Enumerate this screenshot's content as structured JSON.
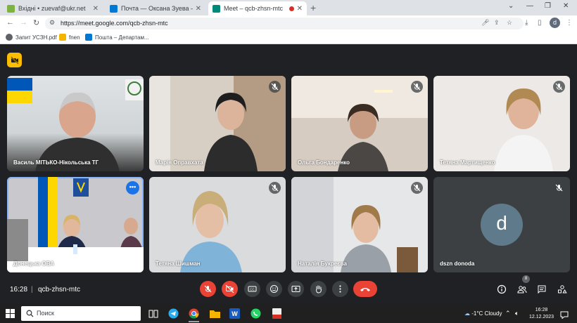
{
  "browser": {
    "tabs": [
      {
        "title": "Вхідні • zuevaf@ukr.net",
        "favicon_color": "#7cb342"
      },
      {
        "title": "Почта — Оксана Зуева — Outl",
        "favicon_color": "#0078d4"
      },
      {
        "title": "Meet – qcb-zhsn-mtc",
        "favicon_color": "#00897b",
        "recording": true
      }
    ],
    "url": "https://meet.google.com/qcb-zhsn-mtc",
    "profile_initial": "d",
    "bookmarks": [
      {
        "label": "Запит УСЗН.pdf",
        "icon": "globe-icon"
      },
      {
        "label": "fnen",
        "icon": "folder-icon",
        "color": "#f4b400"
      },
      {
        "label": "Пошта – Департам...",
        "icon": "outlook-icon",
        "color": "#0078d4"
      }
    ]
  },
  "meet": {
    "participants": [
      {
        "name": "Василь МІТЬКО-Нікольська ТГ",
        "muted": false
      },
      {
        "name": "Марія Оправхата",
        "muted": true
      },
      {
        "name": "Ольга Бондаренко",
        "muted": true
      },
      {
        "name": "Тетяна Мартищенко",
        "muted": true
      },
      {
        "name": "Донецька ОВА",
        "muted": false,
        "pinned_menu": true
      },
      {
        "name": "Тетяна Шишман",
        "muted": true
      },
      {
        "name": "Наталія Букреєва",
        "muted": true
      },
      {
        "name": "dszn donoda",
        "muted": true,
        "avatar_initial": "d"
      }
    ],
    "time": "16:28",
    "separator": "|",
    "meeting_code": "qcb-zhsn-mtc",
    "people_count": "8",
    "accent_red": "#ea4335",
    "accent_yellow": "#fbbc04"
  },
  "taskbar": {
    "search_placeholder": "Поиск",
    "weather": "-1°C  Cloudy",
    "time": "16:28",
    "date": "12.12.2023"
  }
}
